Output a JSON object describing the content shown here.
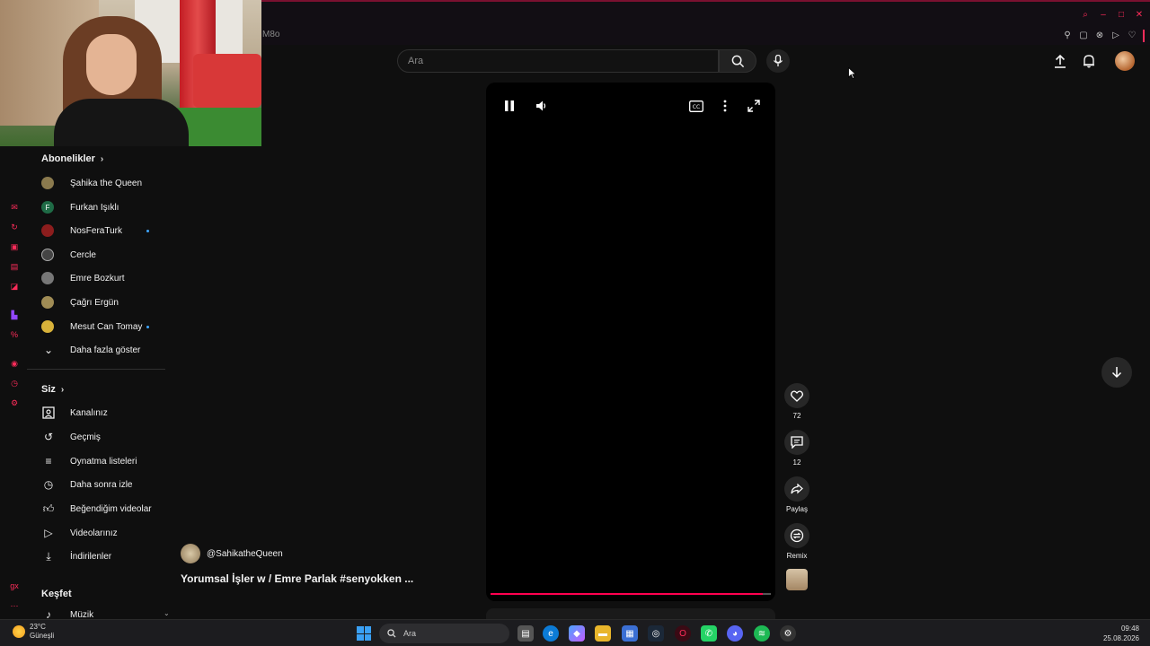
{
  "browser": {
    "url_fragment": "M8o"
  },
  "search": {
    "placeholder": "Ara"
  },
  "sidebar": {
    "subscriptions_title": "Abonelikler",
    "subscriptions": [
      {
        "label": "Şahika the Queen",
        "avatar_color": "#8b7a4e",
        "new": false
      },
      {
        "label": "Furkan Işıklı",
        "avatar_color": "#1f6b46",
        "avatar_letter": "F",
        "new": false
      },
      {
        "label": "NosFeraTurk",
        "avatar_color": "#8c1d1d",
        "new": true
      },
      {
        "label": "Cercle",
        "avatar_color": "#444444",
        "new": false
      },
      {
        "label": "Emre Bozkurt",
        "avatar_color": "#777777",
        "new": false
      },
      {
        "label": "Çağrı Ergün",
        "avatar_color": "#a08c55",
        "new": false
      },
      {
        "label": "Mesut Can Tomay",
        "avatar_color": "#d8b23a",
        "new": true
      }
    ],
    "show_more_label": "Daha fazla göster",
    "you_title": "Siz",
    "you_items": [
      {
        "label": "Kanalınız",
        "icon": "channel-icon"
      },
      {
        "label": "Geçmiş",
        "icon": "history-icon"
      },
      {
        "label": "Oynatma listeleri",
        "icon": "playlist-icon"
      },
      {
        "label": "Daha sonra izle",
        "icon": "watch-later-icon"
      },
      {
        "label": "Beğendiğim videolar",
        "icon": "thumbs-up-icon"
      },
      {
        "label": "Videolarınız",
        "icon": "your-videos-icon"
      },
      {
        "label": "İndirilenler",
        "icon": "download-icon"
      }
    ],
    "explore_title": "Keşfet",
    "explore_first": "Müzik"
  },
  "short": {
    "channel_handle": "@SahikatheQueen",
    "title": "Yorumsal İşler w / Emre Parlak #senyokken ...",
    "progress": 0.97
  },
  "actions": {
    "like_count": "72",
    "comment_count": "12",
    "share_label": "Paylaş",
    "remix_label": "Remix"
  },
  "taskbar": {
    "temp": "23°C",
    "weather": "Güneşli",
    "search_label": "Ara",
    "time": "09:48",
    "date": "25.08.2026"
  },
  "colors": {
    "accent": "#ff2c5a",
    "progress": "#ff0050",
    "new_dot": "#3ea6ff"
  }
}
